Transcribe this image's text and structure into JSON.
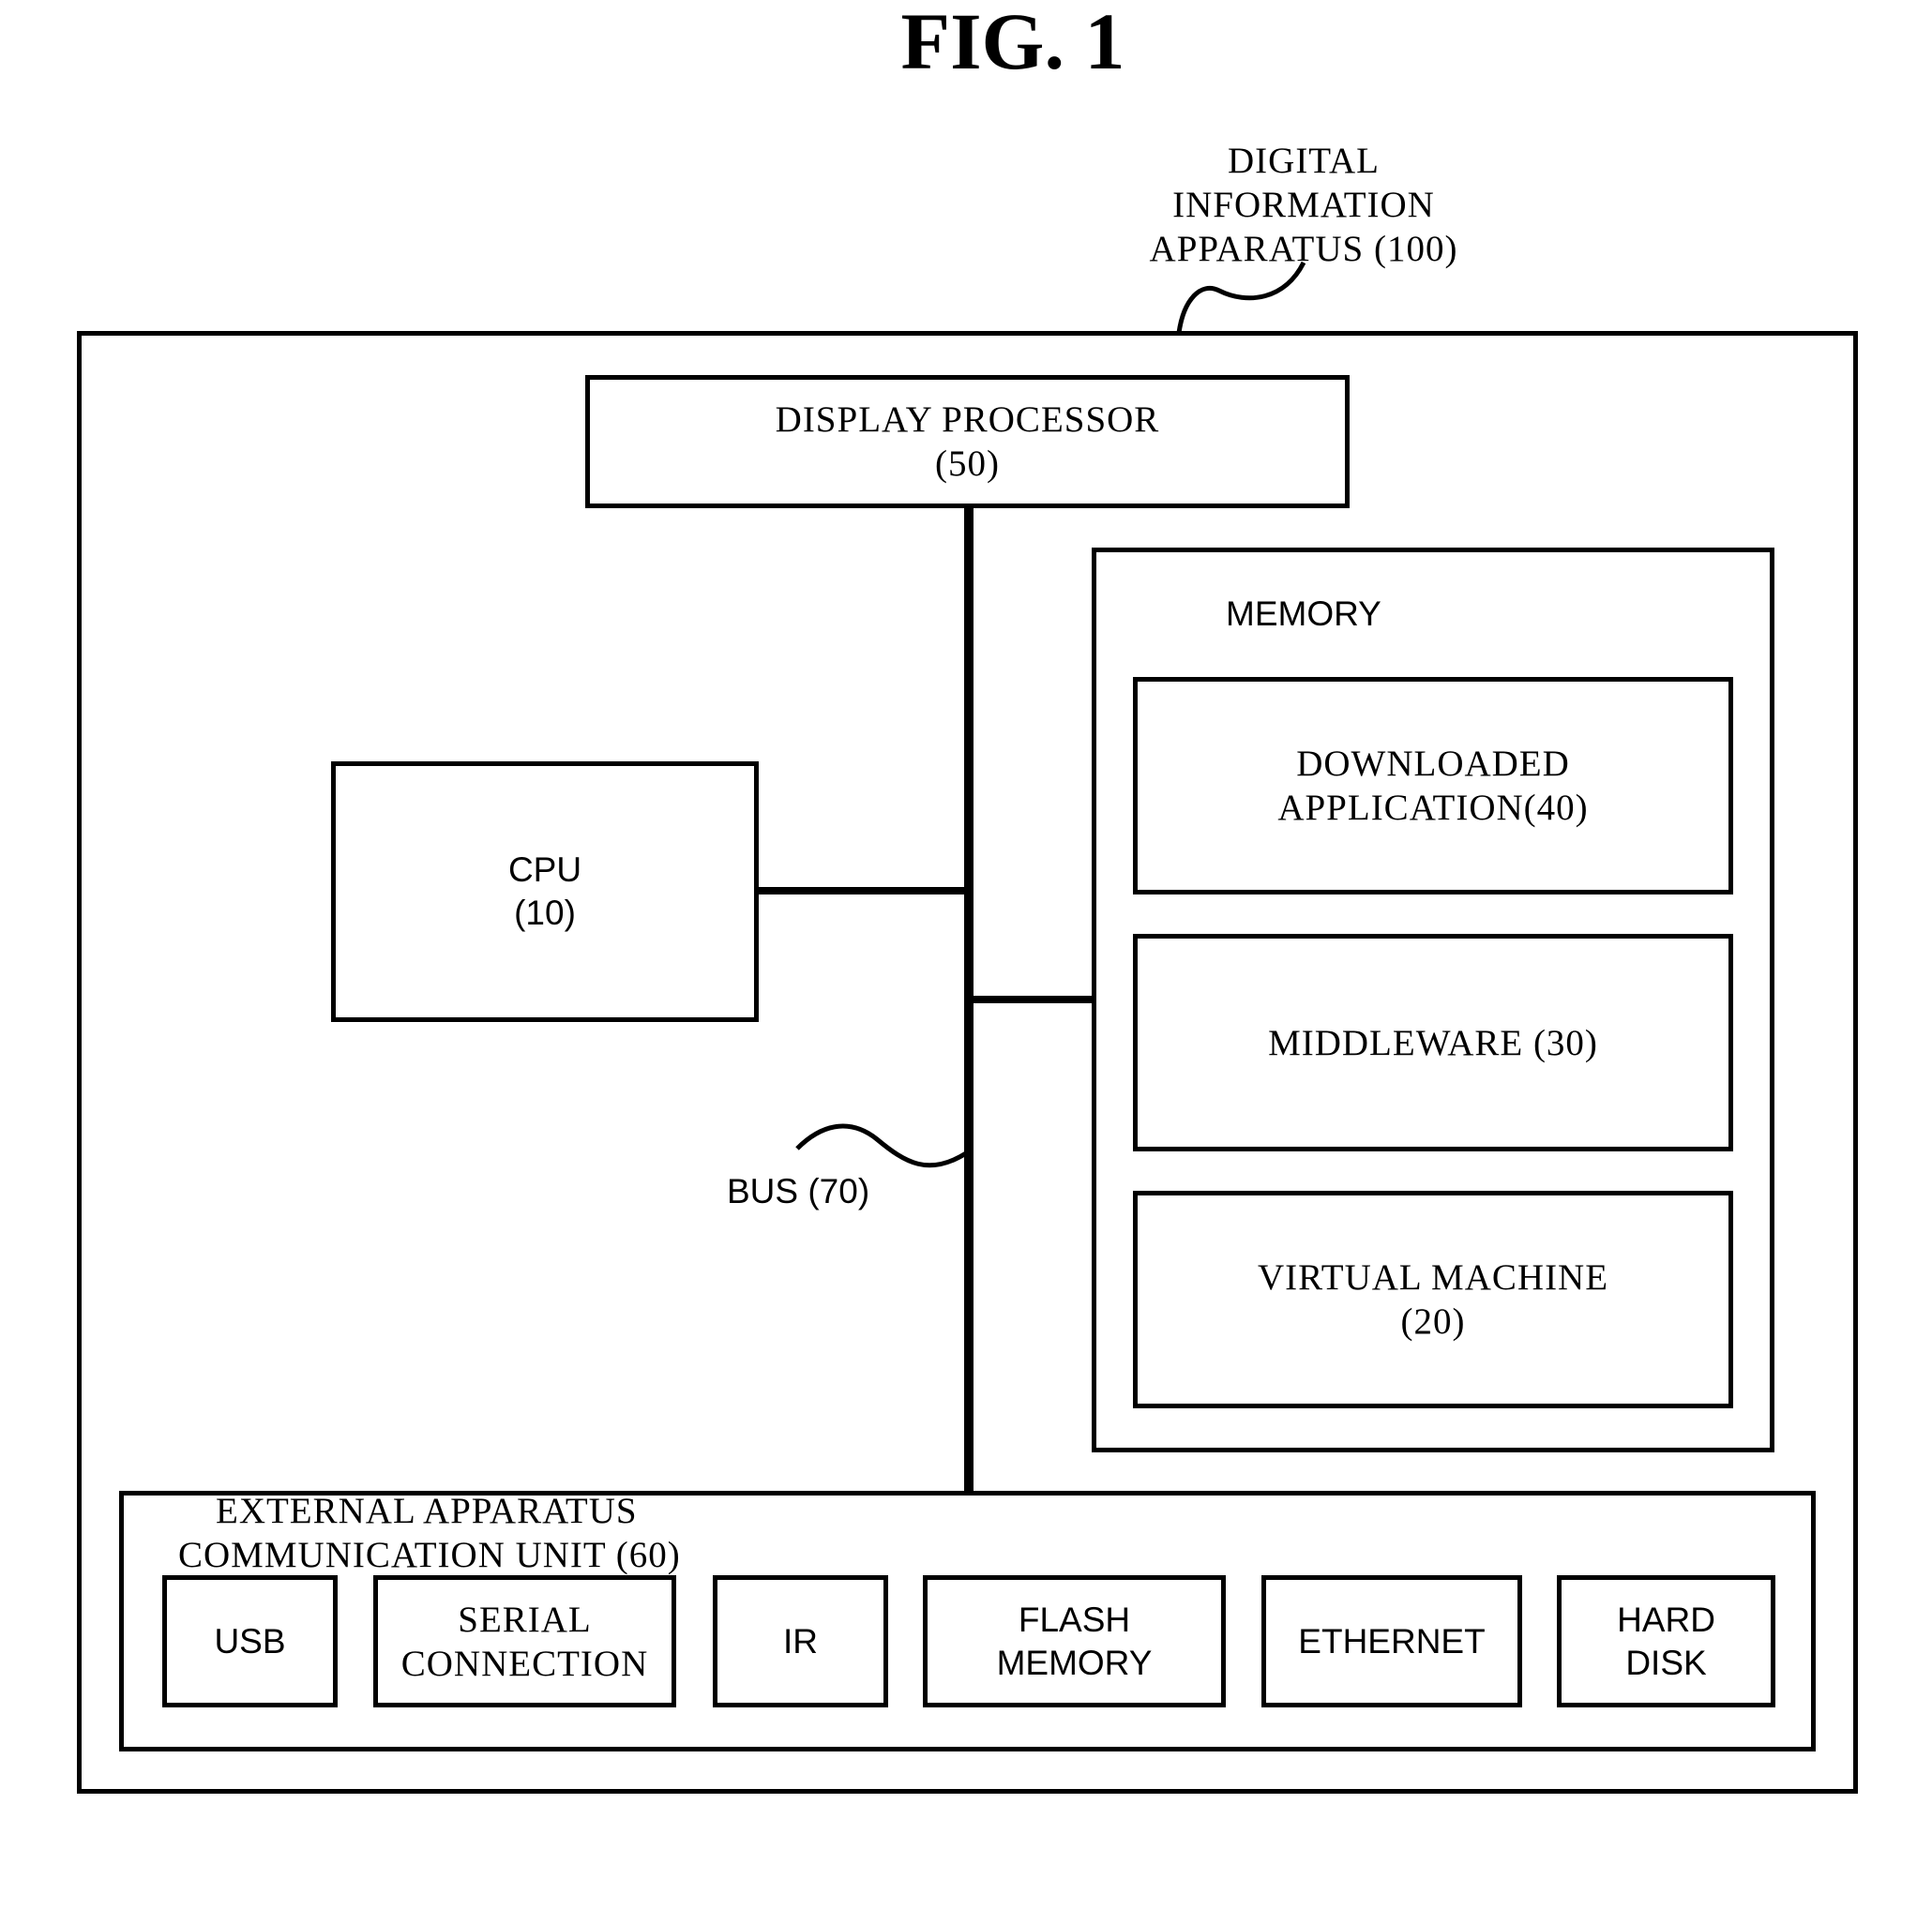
{
  "figure": {
    "title": "FIG. 1"
  },
  "apparatus": {
    "label_lines": [
      "DIGITAL",
      "INFORMATION",
      "APPARATUS (100)"
    ]
  },
  "display_processor": {
    "label_lines": [
      "DISPLAY PROCESSOR",
      "(50)"
    ]
  },
  "cpu": {
    "label_lines": [
      "CPU",
      "(10)"
    ]
  },
  "memory": {
    "label": "MEMORY",
    "blocks": [
      {
        "label_lines": [
          "DOWNLOADED APPLICATION(40)"
        ]
      },
      {
        "label_lines": [
          "MIDDLEWARE (30)"
        ]
      },
      {
        "label_lines": [
          "VIRTUAL MACHINE",
          "(20)"
        ]
      }
    ]
  },
  "bus": {
    "label": "BUS (70)"
  },
  "external_unit": {
    "label_lines": [
      "EXTERNAL APPARATUS",
      "COMMUNICATION UNIT (60)"
    ],
    "ports": [
      {
        "label_lines": [
          "USB"
        ]
      },
      {
        "label_lines": [
          "SERIAL",
          "CONNECTION"
        ]
      },
      {
        "label_lines": [
          "IR"
        ]
      },
      {
        "label_lines": [
          "FLASH",
          "MEMORY"
        ]
      },
      {
        "label_lines": [
          "ETHERNET"
        ]
      },
      {
        "label_lines": [
          "HARD",
          "DISK"
        ]
      }
    ]
  }
}
